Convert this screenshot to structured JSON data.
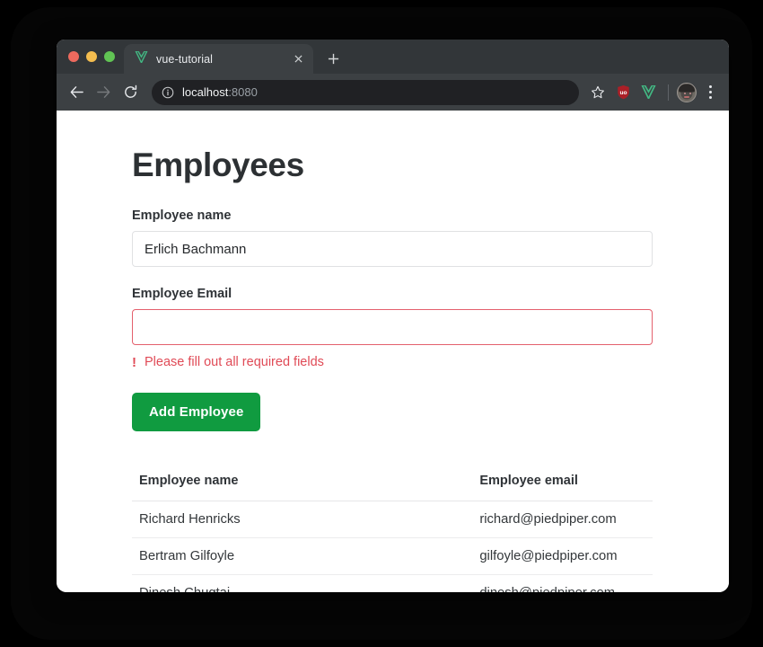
{
  "browser": {
    "traffic_lights": {
      "close_label": "close-window",
      "minimize_label": "minimize-window",
      "maximize_label": "maximize-window",
      "close_color": "#ed6a5e",
      "minimize_color": "#f4bd4f",
      "maximize_color": "#61c454"
    },
    "tab": {
      "title": "vue-tutorial",
      "favicon": "vue-logo-icon",
      "close_icon": "close-icon"
    },
    "new_tab_icon": "plus-icon",
    "toolbar": {
      "back_icon": "arrow-left-icon",
      "forward_icon": "arrow-right-icon",
      "reload_icon": "reload-icon",
      "site_info_icon": "info-circle-icon",
      "url_host": "localhost",
      "url_port": ":8080",
      "url_full": "localhost:8080",
      "bookmark_icon": "star-icon",
      "extensions": [
        {
          "name": "ublock-origin-icon",
          "label": "uBlock Origin",
          "color": "#ab1f27"
        },
        {
          "name": "vue-devtools-icon",
          "label": "Vue.js devtools",
          "color": "#42b883"
        }
      ],
      "avatar_icon": "profile-avatar",
      "menu_icon": "three-dot-menu-icon"
    }
  },
  "page": {
    "title": "Employees",
    "form": {
      "name_label": "Employee name",
      "name_value": "Erlich Bachmann",
      "name_placeholder": "",
      "email_label": "Employee Email",
      "email_value": "",
      "email_placeholder": "",
      "email_invalid": true,
      "error_icon": "!",
      "error_text": "Please fill out all required fields",
      "error_color": "#e04a56",
      "submit_label": "Add Employee",
      "submit_color": "#109b40"
    },
    "table": {
      "columns": [
        "Employee name",
        "Employee email"
      ],
      "rows": [
        {
          "name": "Richard Henricks",
          "email": "richard@piedpiper.com"
        },
        {
          "name": "Bertram Gilfoyle",
          "email": "gilfoyle@piedpiper.com"
        },
        {
          "name": "Dinesh Chugtai",
          "email": "dinesh@piedpiper.com"
        }
      ]
    }
  }
}
